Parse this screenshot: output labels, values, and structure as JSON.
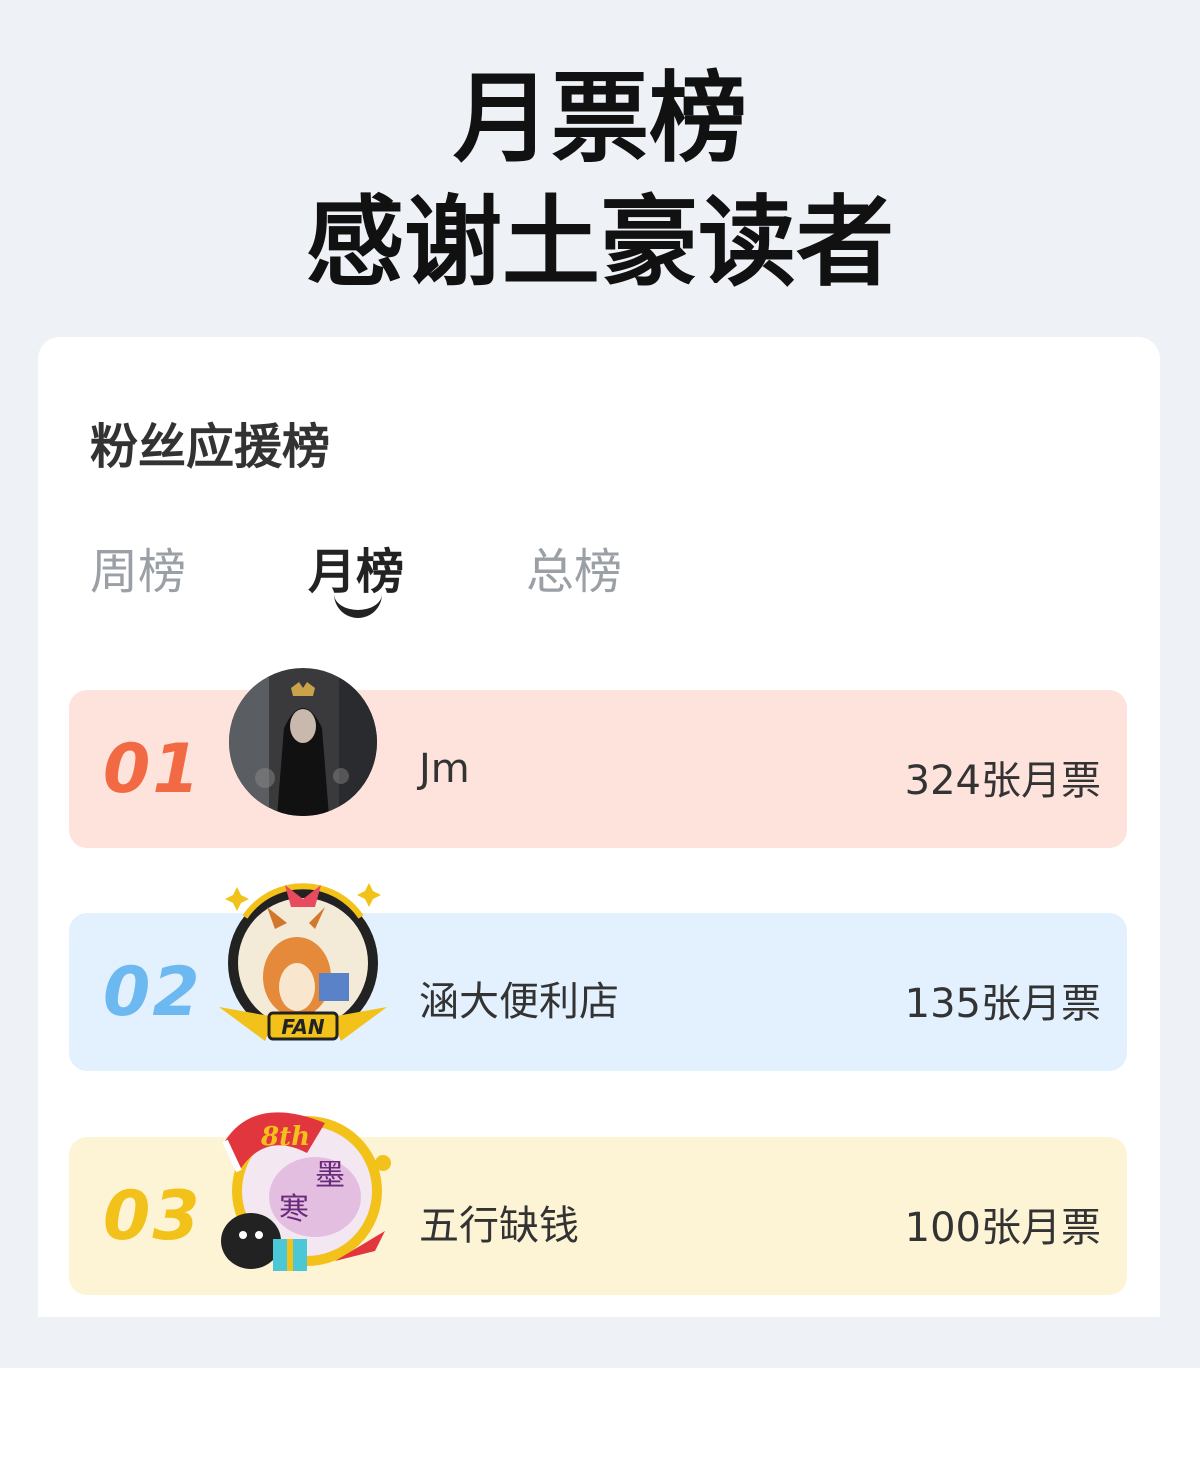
{
  "headline": {
    "line1": "月票榜",
    "line2": "感谢土豪读者"
  },
  "panel": {
    "title": "粉丝应援榜",
    "tabs": [
      {
        "label": "周榜",
        "selected": false
      },
      {
        "label": "月榜",
        "selected": true
      },
      {
        "label": "总榜",
        "selected": false
      }
    ]
  },
  "leaderboard": [
    {
      "rank": "01",
      "name": "Jm",
      "votes": "324张月票",
      "bg": "#fde3dc",
      "rank_color": "#f26a43",
      "avatar": "dark-portrait-avatar"
    },
    {
      "rank": "02",
      "name": "涵大便利店",
      "votes": "135张月票",
      "bg": "#e3f0fd",
      "rank_color": "#6bb9f0",
      "avatar": "corgi-fan-badge-avatar"
    },
    {
      "rank": "03",
      "name": "五行缺钱",
      "votes": "100张月票",
      "bg": "#fdf4d6",
      "rank_color": "#f2c21b",
      "avatar": "gift-badge-avatar"
    }
  ],
  "colors": {
    "page_bg": "#eef2f6",
    "card_bg": "#ffffff"
  }
}
